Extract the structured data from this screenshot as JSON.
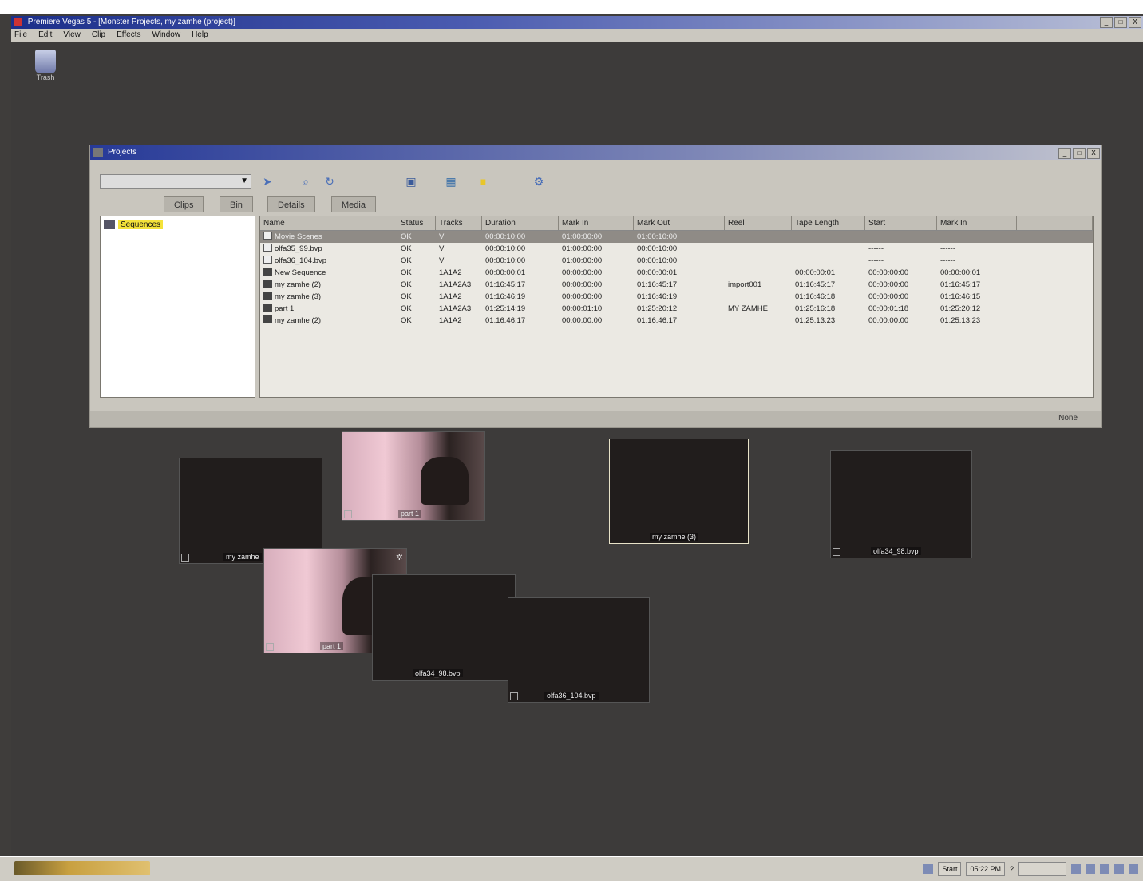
{
  "app": {
    "title": "Premiere Vegas 5 - [Monster Projects, my zamhe (project)]",
    "menu": [
      "File",
      "Edit",
      "View",
      "Clip",
      "Effects",
      "Window",
      "Help"
    ],
    "window_buttons": [
      "_",
      "□",
      "X"
    ]
  },
  "desktop": {
    "trash_label": "Trash"
  },
  "project_window": {
    "title": "Projects",
    "tabs": [
      "Clips",
      "Bin",
      "Details",
      "Media"
    ],
    "tree_root": "Sequences",
    "columns": [
      "Name",
      "Status",
      "Tracks",
      "Duration",
      "Mark In",
      "Mark Out",
      "Reel",
      "Tape Length",
      "Start",
      "Mark In"
    ],
    "rows": [
      {
        "name": "Movie Scenes",
        "status": "OK",
        "tracks": "V",
        "duration": "00:00:10:00",
        "mark_in": "01:00:00:00",
        "mark_out": "01:00:10:00",
        "reel": "",
        "tape": "",
        "start": "",
        "end": "",
        "icon": "clip",
        "selected": true
      },
      {
        "name": "olfa35_99.bvp",
        "status": "OK",
        "tracks": "V",
        "duration": "00:00:10:00",
        "mark_in": "01:00:00:00",
        "mark_out": "00:00:10:00",
        "reel": "",
        "tape": "",
        "start": "------",
        "end": "------",
        "icon": "clip"
      },
      {
        "name": "olfa36_104.bvp",
        "status": "OK",
        "tracks": "V",
        "duration": "00:00:10:00",
        "mark_in": "01:00:00:00",
        "mark_out": "00:00:10:00",
        "reel": "",
        "tape": "",
        "start": "------",
        "end": "------",
        "icon": "clip"
      },
      {
        "name": "New Sequence",
        "status": "OK",
        "tracks": "1A1A2",
        "duration": "00:00:00:01",
        "mark_in": "00:00:00:00",
        "mark_out": "00:00:00:01",
        "reel": "",
        "tape": "00:00:00:01",
        "start": "00:00:00:00",
        "end": "00:00:00:01",
        "icon": "seq"
      },
      {
        "name": "my zamhe (2)",
        "status": "OK",
        "tracks": "1A1A2A3",
        "duration": "01:16:45:17",
        "mark_in": "00:00:00:00",
        "mark_out": "01:16:45:17",
        "reel": "import001",
        "tape": "01:16:45:17",
        "start": "00:00:00:00",
        "end": "01:16:45:17",
        "icon": "seq"
      },
      {
        "name": "my zamhe (3)",
        "status": "OK",
        "tracks": "1A1A2",
        "duration": "01:16:46:19",
        "mark_in": "00:00:00:00",
        "mark_out": "01:16:46:19",
        "reel": "",
        "tape": "01:16:46:18",
        "start": "00:00:00:00",
        "end": "01:16:46:15",
        "icon": "seq"
      },
      {
        "name": "part 1",
        "status": "OK",
        "tracks": "1A1A2A3",
        "duration": "01:25:14:19",
        "mark_in": "00:00:01:10",
        "mark_out": "01:25:20:12",
        "reel": "MY ZAMHE",
        "tape": "01:25:16:18",
        "start": "00:00:01:18",
        "end": "01:25:20:12",
        "icon": "seq"
      },
      {
        "name": "my zamhe (2)",
        "status": "OK",
        "tracks": "1A1A2",
        "duration": "01:16:46:17",
        "mark_in": "00:00:00:00",
        "mark_out": "01:16:46:17",
        "reel": "",
        "tape": "01:25:13:23",
        "start": "00:00:00:00",
        "end": "01:25:13:23",
        "icon": "seq"
      }
    ],
    "status_text": "None"
  },
  "thumbnails": [
    {
      "label": "my zamhe"
    },
    {
      "label": "part 1"
    },
    {
      "label": "my zamhe (3)"
    },
    {
      "label": "olfa34_98.bvp"
    },
    {
      "label": "part 1"
    },
    {
      "label": "olfa34_98.bvp"
    },
    {
      "label": "olfa36_104.bvp"
    }
  ],
  "taskbar": {
    "tray": [
      "Start",
      "05:22 PM",
      "?"
    ]
  }
}
